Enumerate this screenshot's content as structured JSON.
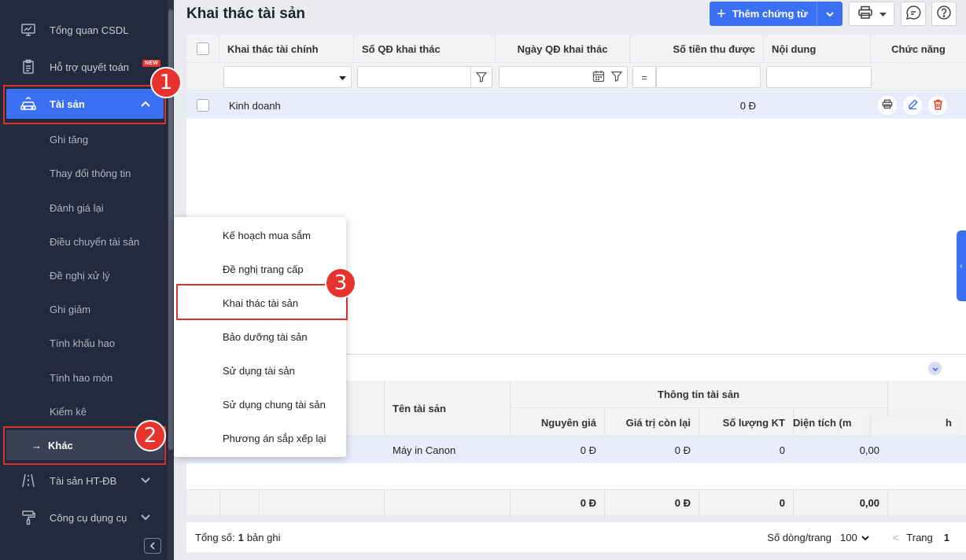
{
  "sidebar": {
    "items": [
      {
        "label": "Tổng quan CSDL",
        "icon": "monitor-chart-icon"
      },
      {
        "label": "Hỗ trợ quyết toán",
        "icon": "clipboard-list-icon",
        "badge": "NEW"
      },
      {
        "label": "Tài sản",
        "icon": "car-icon"
      },
      {
        "label": "Tài sản HT-ĐB",
        "icon": "road-icon"
      },
      {
        "label": "Công cụ dụng cụ",
        "icon": "paint-roller-icon"
      }
    ],
    "sub_items": [
      "Ghi tăng",
      "Thay đổi thông tin",
      "Đánh giá lại",
      "Điều chuyển tài sản",
      "Đề nghị xử lý",
      "Ghi giảm",
      "Tính khấu hao",
      "Tính hao mòn",
      "Kiểm kê"
    ],
    "current_sub": "Khác",
    "accent": "#3b6ff4",
    "bg": "#232a3b"
  },
  "steps": [
    "1",
    "2",
    "3"
  ],
  "header": {
    "title": "Khai thác tài sản",
    "add_button": "Thêm chứng từ"
  },
  "table": {
    "columns": [
      "Khai thác tài chính",
      "Số QĐ khai thác",
      "Ngày QĐ khai thác",
      "Số tiền thu được",
      "Nội dung",
      "Chức năng"
    ],
    "filter_operator": "=",
    "rows": [
      {
        "khai_thac_tai_chinh": "Kinh doanh",
        "so_tien": "0 Đ"
      }
    ]
  },
  "detail": {
    "group_header": "Thông tin tài sản",
    "columns": [
      "Tên tài sản",
      "Nguyên giá",
      "Giá trị còn lại",
      "Số lượng KT",
      "Diện tích (m",
      "h"
    ],
    "row": {
      "ten": "Máy in Canon",
      "nguyen_gia": "0 Đ",
      "gia_tri_con_lai": "0 Đ",
      "so_luong": "0",
      "dien_tich": "0,00"
    },
    "totals": {
      "nguyen_gia": "0 Đ",
      "gia_tri_con_lai": "0 Đ",
      "so_luong": "0",
      "dien_tich": "0,00"
    }
  },
  "footer": {
    "total_prefix": "Tổng số:",
    "total_count": "1",
    "total_suffix": "bản ghi",
    "rows_per_page_label": "Số dòng/trang",
    "rows_per_page": "100",
    "page_label": "Trang",
    "page": "1"
  },
  "popup_menu": [
    "Kế hoạch mua sắm",
    "Đề nghị trang cấp",
    "Khai thác tài sản",
    "Bảo dưỡng tài sản",
    "Sử dụng tài sản",
    "Sử dụng chung tài sản",
    "Phương án sắp xếp lại"
  ]
}
